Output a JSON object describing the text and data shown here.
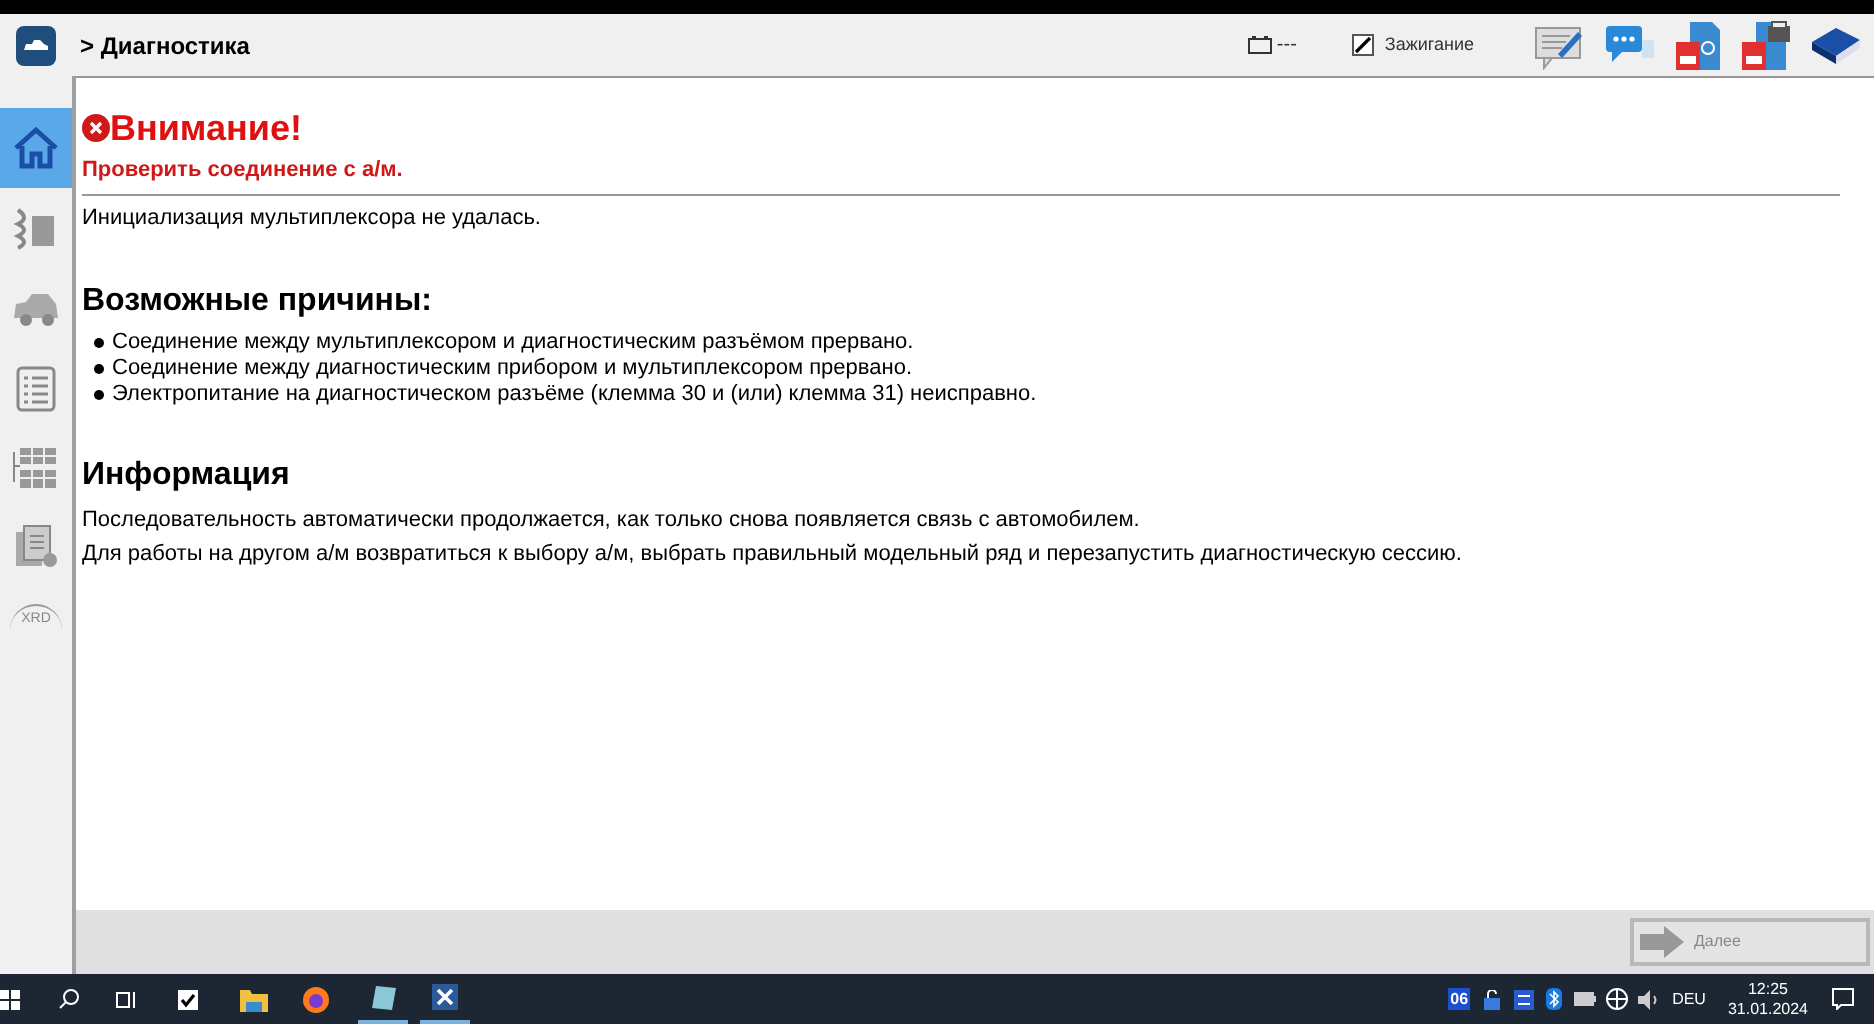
{
  "header": {
    "breadcrumb": "> Диагностика",
    "battery_reading": "---",
    "ignition": {
      "label": "Зажигание",
      "checked": true
    }
  },
  "sidebar": {
    "items": [
      {
        "kind": "home",
        "selected": true
      },
      {
        "kind": "module",
        "selected": false
      },
      {
        "kind": "car",
        "selected": false
      },
      {
        "kind": "list",
        "selected": false
      },
      {
        "kind": "grid",
        "selected": false
      },
      {
        "kind": "docs",
        "selected": false
      }
    ],
    "logo": "XRD"
  },
  "alert": {
    "title": "Внимание!",
    "subtitle": "Проверить соединение с а/м.",
    "message": "Инициализация мультиплексора не удалась."
  },
  "causes": {
    "heading": "Возможные причины:",
    "items": [
      "Соединение между мультиплексором и диагностическим разъёмом прервано.",
      "Соединение между диагностическим прибором и мультиплексором прервано.",
      "Электропитание на диагностическом разъёме (клемма 30 и (или) клемма 31) неисправно."
    ]
  },
  "info": {
    "heading": "Информация",
    "paragraphs": [
      "Последовательность автоматически продолжается, как только снова появляется связь с автомобилем.",
      "Для работы на другом а/м возвратиться к выбору а/м, выбрать правильный модельный ряд и перезапустить диагностическую сессию."
    ]
  },
  "footer": {
    "next_button": {
      "label": "Далее",
      "disabled": true
    }
  },
  "taskbar": {
    "badge": "06",
    "language": "DEU",
    "time": "12:25",
    "date": "31.01.2024"
  }
}
